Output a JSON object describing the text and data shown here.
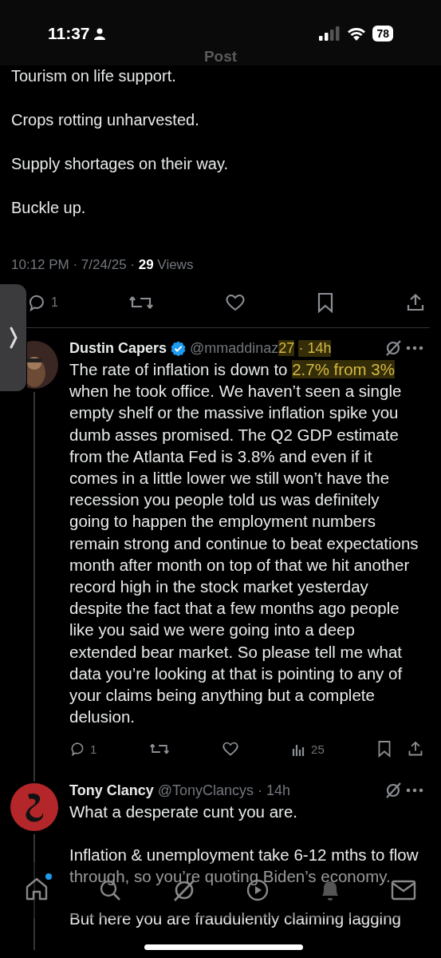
{
  "status_bar": {
    "time": "11:37",
    "battery": "78"
  },
  "header": {
    "title": "Post"
  },
  "post": {
    "paragraphs": [
      "Tourism on life support.",
      "Crops rotting unharvested.",
      "Supply shortages on their way.",
      "Buckle up."
    ],
    "time": "10:12 PM · 7/24/25 · ",
    "views_count": "29",
    "views_label": " Views",
    "reply_count": "1"
  },
  "replies": [
    {
      "name": "Dustin Capers",
      "verified": true,
      "handle": [
        {
          "text": "@mmaddinaz",
          "highlight": false
        },
        {
          "text": "27",
          "highlight": true
        }
      ],
      "time": "· 14h",
      "time_highlight": true,
      "body": [
        [
          {
            "text": "The rate of inflation is down to ",
            "highlight": false
          },
          {
            "text": "2.7% from 3%",
            "highlight": true
          },
          {
            "text": " when he took office. We haven’t seen a single empty shelf or the massive inflation spike you dumb asses promised. The Q2 GDP estimate from the Atlanta Fed is 3.8% and even if it comes in a little lower we still won’t have the recession you people told us was definitely going to happen the employment numbers remain strong and continue to beat expectations month after month on top of that we hit another record high in the stock market yesterday despite the fact that a few months ago people like you said we were going into a deep extended bear market. So please tell me what data you’re looking at that is pointing to any of your claims being anything but a complete delusion.",
            "highlight": false
          }
        ]
      ],
      "reply_count": "1",
      "views": "25"
    },
    {
      "name": "Tony Clancy",
      "verified": false,
      "handle": [
        {
          "text": "@TonyClancys",
          "highlight": false
        }
      ],
      "time": "· 14h",
      "time_highlight": false,
      "body": [
        [
          {
            "text": "What a desperate cunt you are.",
            "highlight": false
          }
        ],
        [
          {
            "text": "Inflation & unemployment take 6-12 mths to flow through, so you’re quoting Biden’s economy.",
            "highlight": false
          }
        ],
        [
          {
            "text": "But here you are fraudulently claiming lagging",
            "highlight": false
          }
        ]
      ]
    }
  ],
  "tab_bar": {
    "home_unread": true
  }
}
